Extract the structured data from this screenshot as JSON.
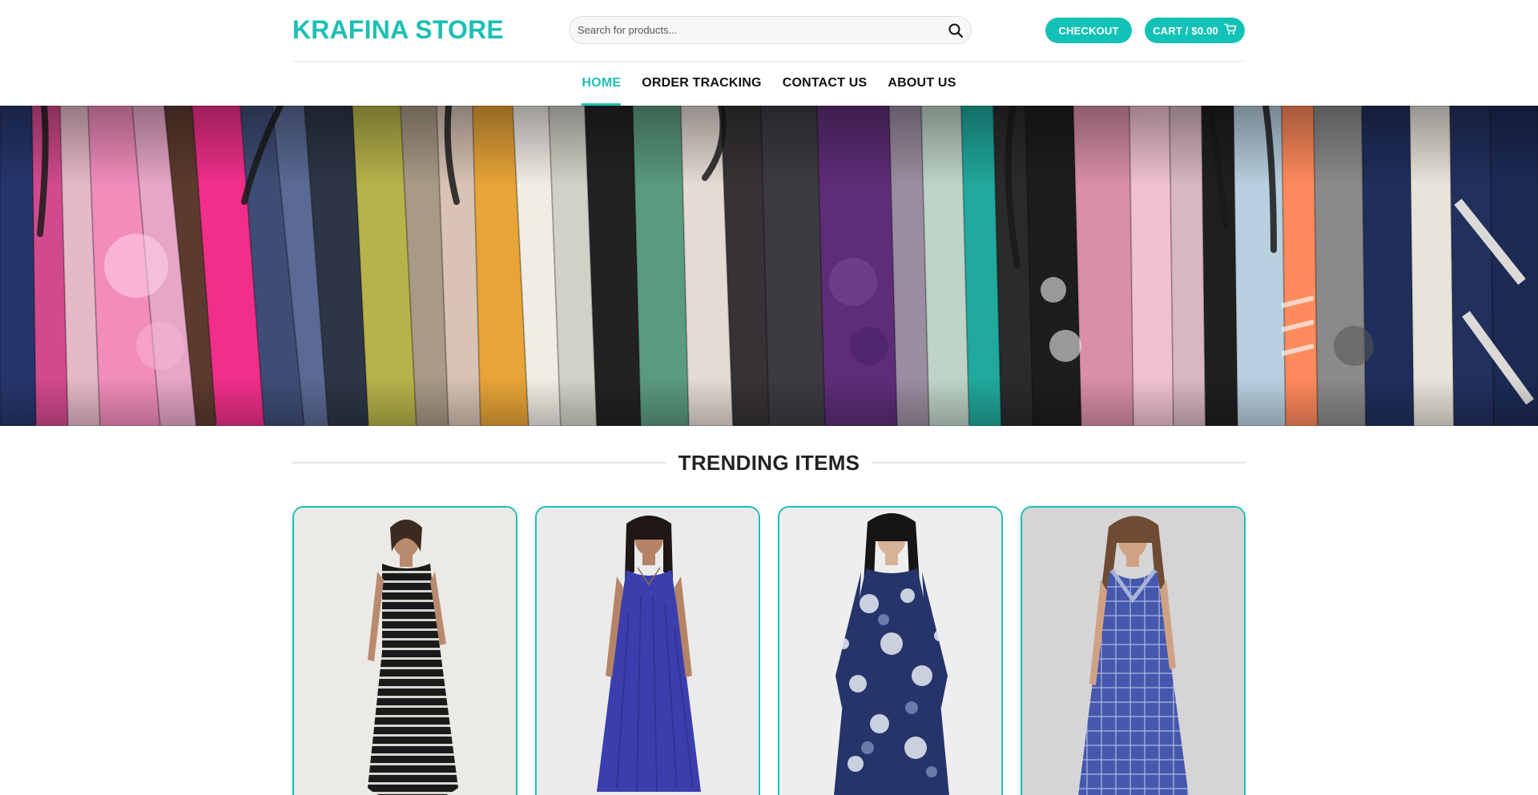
{
  "header": {
    "logo": "KRAFINA STORE",
    "search_placeholder": "Search for products...",
    "checkout_label": "CHECKOUT",
    "cart_label": "CART / $0.00",
    "search_icon": "search-icon",
    "cart_icon": "cart-icon"
  },
  "nav": {
    "items": [
      {
        "label": "HOME",
        "active": true
      },
      {
        "label": "ORDER TRACKING",
        "active": false
      },
      {
        "label": "CONTACT US",
        "active": false
      },
      {
        "label": "ABOUT US",
        "active": false
      }
    ]
  },
  "sections": {
    "trending_title": "TRENDING ITEMS"
  },
  "colors": {
    "accent": "#1cbfb4",
    "nav_text": "#111111"
  }
}
